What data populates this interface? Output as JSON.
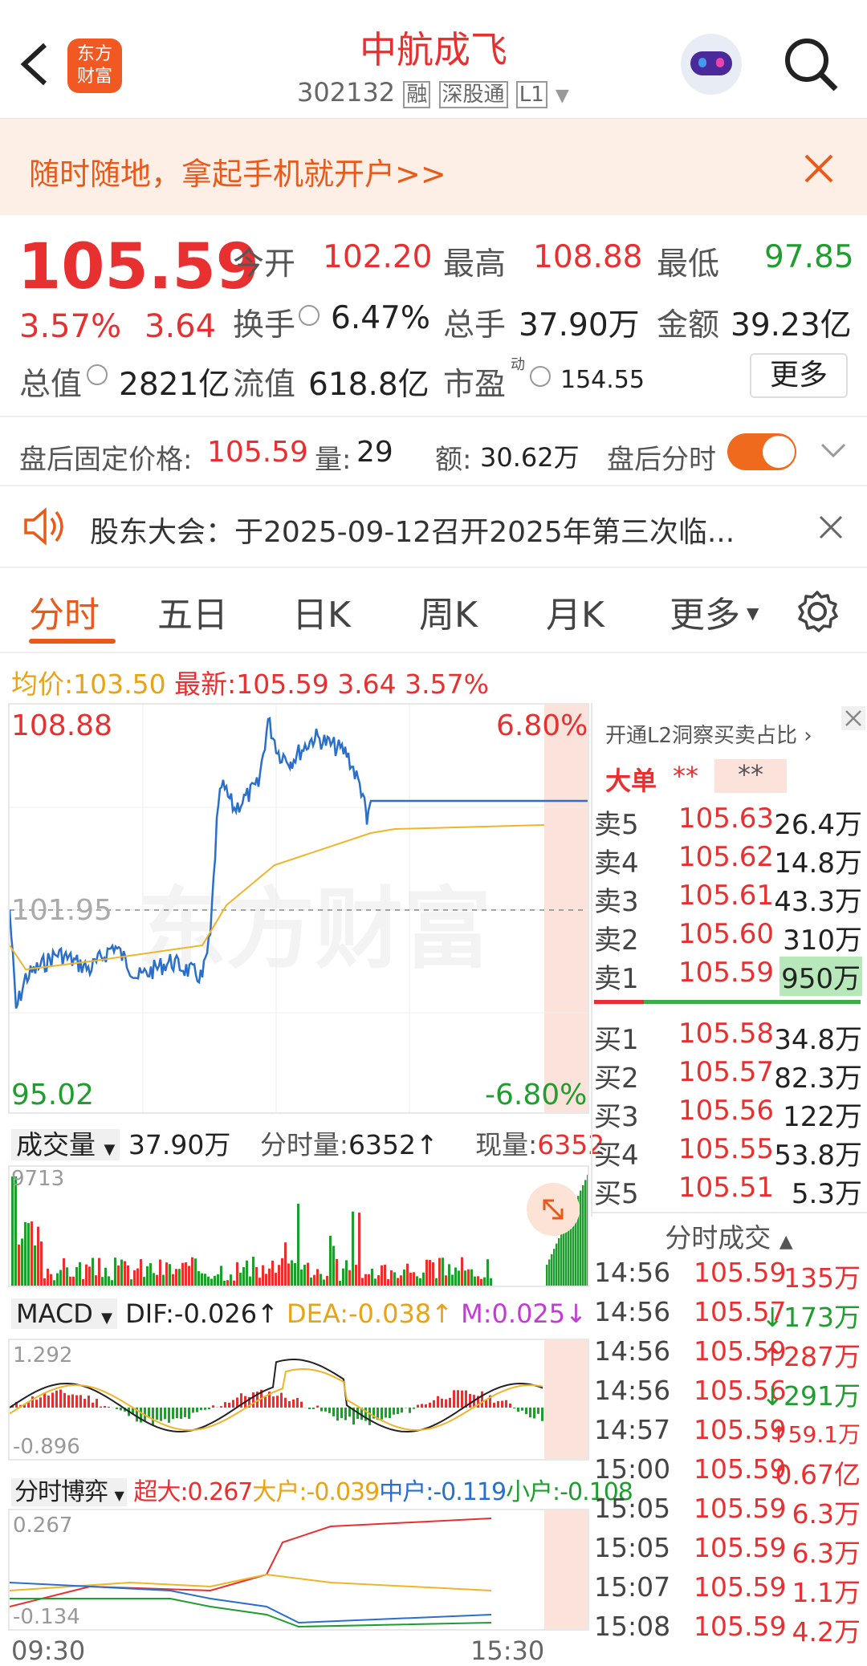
{
  "header": {
    "title": "中航成飞",
    "code": "302132",
    "tag_rong": "融",
    "tag_sgt": "深股通",
    "tag_l1": "L1",
    "logo_line1": "东方",
    "logo_line2": "财富"
  },
  "banner": {
    "text": "随时随地，拿起手机就开户>>"
  },
  "quote": {
    "price": "105.59",
    "pct": "3.57%",
    "chg": "3.64",
    "open_label": "今开",
    "open": "102.20",
    "high_label": "最高",
    "high": "108.88",
    "low_label": "最低",
    "low": "97.85",
    "turnover_label": "换手",
    "turnover": "6.47%",
    "vol_label": "总手",
    "vol": "37.90万",
    "amt_label": "金额",
    "amt": "39.23亿",
    "mcap_label": "总值",
    "mcap": "2821亿",
    "float_label": "流值",
    "float": "618.8亿",
    "pe_label": "市盈",
    "pe_sup": "动",
    "pe": "154.55",
    "more": "更多"
  },
  "after": {
    "label": "盘后固定价格:",
    "price": "105.59",
    "vol_label": "量:",
    "vol": "29",
    "amt_label": "额:",
    "amt": "30.62万",
    "toggle_label": "盘后分时"
  },
  "notice": {
    "text": "股东大会：于2025-09-12召开2025年第三次临..."
  },
  "tabs": [
    "分时",
    "五日",
    "日K",
    "周K",
    "月K",
    "更多"
  ],
  "info_line": {
    "avg_label": "均价:",
    "avg": "103.50",
    "new_label": "最新:",
    "new": "105.59",
    "chg": "3.64",
    "pct": "3.57%"
  },
  "chart": {
    "max": "108.88",
    "min": "95.02",
    "ref": "101.95",
    "max_pct": "6.80%",
    "min_pct": "-6.80%",
    "watermark": "东方财富",
    "start_time": "09:30",
    "end_time": "15:30"
  },
  "volume": {
    "selector": "成交量",
    "total": "37.90万",
    "tick_label": "分时量:",
    "tick": "6352",
    "now_label": "现量:",
    "now": "6352",
    "axis": "9713"
  },
  "macd": {
    "selector": "MACD",
    "dif": "DIF:-0.026",
    "dea": "DEA:-0.038",
    "m": "M:0.025",
    "top": "1.292",
    "bottom": "-0.896"
  },
  "game": {
    "selector": "分时博弈",
    "super": "超大:0.267",
    "big": "大户:-0.039",
    "mid": "中户:-0.119",
    "small": "小户:-0.108",
    "top": "0.267",
    "bottom": "-0.134"
  },
  "orderbook": {
    "header": "开通L2洞察买卖占比",
    "big_label": "大单",
    "big_a": "**",
    "big_b": "**",
    "asks": [
      {
        "l": "卖5",
        "p": "105.63",
        "v": "26.4万"
      },
      {
        "l": "卖4",
        "p": "105.62",
        "v": "14.8万"
      },
      {
        "l": "卖3",
        "p": "105.61",
        "v": "43.3万"
      },
      {
        "l": "卖2",
        "p": "105.60",
        "v": "310万"
      },
      {
        "l": "卖1",
        "p": "105.59",
        "v": "950万"
      }
    ],
    "bids": [
      {
        "l": "买1",
        "p": "105.58",
        "v": "34.8万"
      },
      {
        "l": "买2",
        "p": "105.57",
        "v": "82.3万"
      },
      {
        "l": "买3",
        "p": "105.56",
        "v": "122万"
      },
      {
        "l": "买4",
        "p": "105.55",
        "v": "53.8万"
      },
      {
        "l": "买5",
        "p": "105.51",
        "v": "5.3万"
      }
    ]
  },
  "trades": {
    "header": "分时成交",
    "rows": [
      {
        "t": "14:56",
        "p": "105.59",
        "v": "135万"
      },
      {
        "t": "14:56",
        "p": "105.57",
        "v": "↓173万"
      },
      {
        "t": "14:56",
        "p": "105.59",
        "v": "↑287万"
      },
      {
        "t": "14:56",
        "p": "105.56",
        "v": "↓291万"
      },
      {
        "t": "14:57",
        "p": "105.59",
        "v": "↑59.1万"
      },
      {
        "t": "15:00",
        "p": "105.59",
        "v": "0.67亿"
      },
      {
        "t": "15:05",
        "p": "105.59",
        "v": "6.3万"
      },
      {
        "t": "15:05",
        "p": "105.59",
        "v": "6.3万"
      },
      {
        "t": "15:07",
        "p": "105.59",
        "v": "1.1万"
      },
      {
        "t": "15:08",
        "p": "105.59",
        "v": "4.2万"
      }
    ]
  }
}
